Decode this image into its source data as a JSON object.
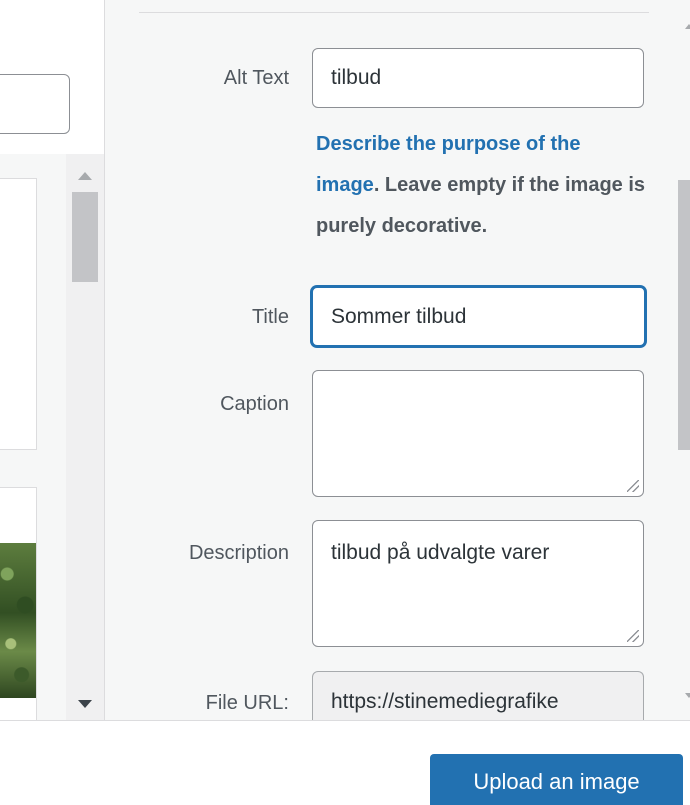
{
  "attachment_details": {
    "alt_text": {
      "label": "Alt Text",
      "value": "tilbud"
    },
    "alt_help": {
      "link_text": "Describe the purpose of the image",
      "rest_text": ". Leave empty if the image is purely decorative."
    },
    "title": {
      "label": "Title",
      "value": "Sommer tilbud"
    },
    "caption": {
      "label": "Caption",
      "value": ""
    },
    "description": {
      "label": "Description",
      "value": "tilbud på udvalgte varer"
    },
    "file_url": {
      "label": "File URL:",
      "value": "https://stinemediegrafike"
    }
  },
  "toolbar": {
    "upload_label": "Upload an image"
  },
  "colors": {
    "accent": "#2271b1",
    "link": "#2271b1",
    "panel_bg": "#f6f7f7"
  }
}
